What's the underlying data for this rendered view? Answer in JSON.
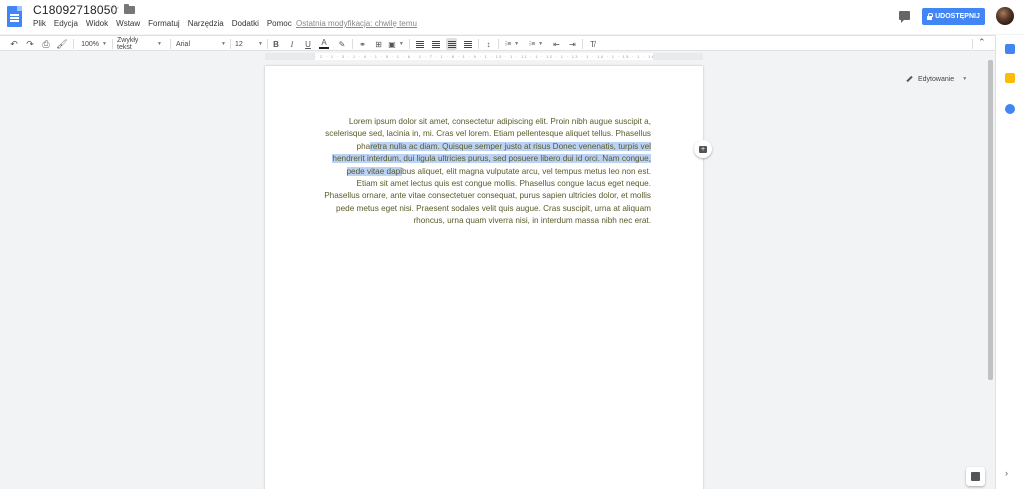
{
  "header": {
    "title": "C18092718050",
    "menu": [
      "Plik",
      "Edycja",
      "Widok",
      "Wstaw",
      "Formatuj",
      "Narzędzia",
      "Dodatki",
      "Pomoc"
    ],
    "last_edit": "Ostatnia modyfikacja: chwilę temu",
    "share_label": "UDOSTĘPNIJ"
  },
  "toolbar": {
    "zoom": "100%",
    "style": "Zwykły tekst",
    "font": "Arial",
    "size": "12",
    "mode": "Edytowanie"
  },
  "ruler": "1 · 2 · 1 · 1 · 1 · 2 · 1 · 3 · 1 · 4 · 1 · 5 · 1 · 6 · 1 · 7 · 1 · 8 · 1 · 9 · 1 · 10 · 1 · 11 · 1 · 12 · 1 · 13 · 1 · 14 · 1 · 15 · 1 · 16 · 1 · 17 · 1 · 18 · 1 · 19",
  "document": {
    "before": "Lorem ipsum dolor sit amet, consectetur adipiscing elit. Proin nibh augue suscipit a, scelerisque sed, lacinia in, mi. Cras vel lorem. Etiam pellentesque aliquet tellus. Phasellus pha",
    "selected": "retra nulla ac diam. Quisque semper justo at risus Donec venenatis, turpis vel hendrerit interdum, dui ligula ultricies purus, sed posuere libero dui id orci. Nam congue, pede vitae dapi",
    "after": "bus aliquet, elit magna vulputate arcu, vel tempus metus leo non est. Etiam sit amet lectus quis est congue mollis. Phasellus congue lacus eget neque. Phasellus ornare, ante vitae consectetuer consequat, purus sapien ultricies dolor, et mollis pede metus eget nisi. Praesent sodales velit quis augue. Cras suscipit, urna at aliquam rhoncus, urna quam viverra nisi, in interdum massa nibh nec erat."
  },
  "colors": {
    "accent": "#4285f4",
    "selection": "#bbd2f5",
    "text": "#5a5a2a"
  }
}
